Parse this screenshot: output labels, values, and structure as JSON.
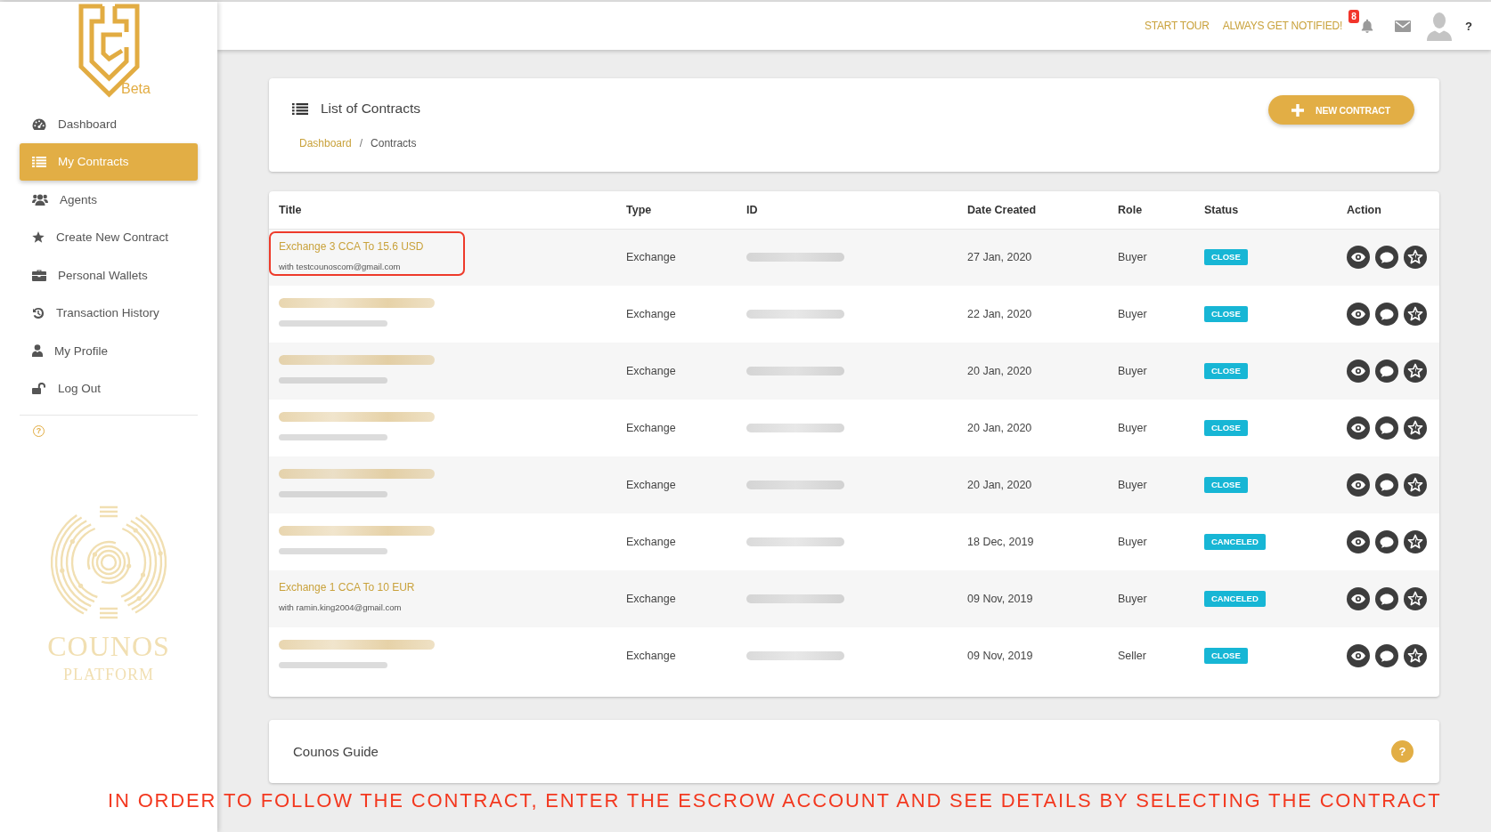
{
  "sidebar": {
    "badge": "Beta",
    "items": [
      {
        "label": "Dashboard",
        "selected": false
      },
      {
        "label": "My Contracts",
        "selected": true
      },
      {
        "label": "Agents",
        "selected": false
      },
      {
        "label": "Create New Contract",
        "selected": false
      },
      {
        "label": "Personal Wallets",
        "selected": false
      },
      {
        "label": "Transaction History",
        "selected": false
      },
      {
        "label": "My Profile",
        "selected": false
      },
      {
        "label": "Log Out",
        "selected": false
      }
    ],
    "help": "?",
    "brand": {
      "name": "COUNOS",
      "tagline": "PLATFORM"
    }
  },
  "topbar": {
    "links": [
      "START TOUR",
      "ALWAYS GET NOTIFIED!"
    ],
    "notification_count": "8",
    "help": "?"
  },
  "header": {
    "title": "List of Contracts",
    "breadcrumb": [
      {
        "label": "Dashboard",
        "kind": "link"
      },
      {
        "label": "Contracts",
        "kind": "current"
      }
    ],
    "separator": "/",
    "button": "NEW CONTRACT"
  },
  "table": {
    "columns": [
      "Title",
      "Type",
      "ID",
      "Date Created",
      "Role",
      "Status",
      "Action"
    ],
    "rows": [
      {
        "blurred": false,
        "title": "Exchange 3 CCA To 15.6 USD",
        "email": "with testcounoscom@gmail.com",
        "type": "Exchange",
        "date": "27 Jan, 2020",
        "role": "Buyer",
        "status": "CLOSE",
        "highlighted": true
      },
      {
        "blurred": true,
        "type": "Exchange",
        "date": "22 Jan, 2020",
        "role": "Buyer",
        "status": "CLOSE",
        "highlighted": false
      },
      {
        "blurred": true,
        "type": "Exchange",
        "date": "20 Jan, 2020",
        "role": "Buyer",
        "status": "CLOSE",
        "highlighted": false
      },
      {
        "blurred": true,
        "type": "Exchange",
        "date": "20 Jan, 2020",
        "role": "Buyer",
        "status": "CLOSE",
        "highlighted": false
      },
      {
        "blurred": true,
        "type": "Exchange",
        "date": "20 Jan, 2020",
        "role": "Buyer",
        "status": "CLOSE",
        "highlighted": false
      },
      {
        "blurred": true,
        "type": "Exchange",
        "date": "18 Dec, 2019",
        "role": "Buyer",
        "status": "CANCELED",
        "highlighted": false
      },
      {
        "blurred": false,
        "title": "Exchange 1 CCA To 10 EUR",
        "email": "with ramin.king2004@gmail.com",
        "type": "Exchange",
        "date": "09 Nov, 2019",
        "role": "Buyer",
        "status": "CANCELED",
        "highlighted": false
      },
      {
        "blurred": true,
        "type": "Exchange",
        "date": "09 Nov, 2019",
        "role": "Seller",
        "status": "CLOSE",
        "highlighted": false
      }
    ]
  },
  "guide": {
    "title": "Counos Guide",
    "help": "?"
  },
  "annotation": {
    "caption": "IN ORDER TO FOLLOW THE CONTRACT, ENTER THE ESCROW ACCOUNT AND SEE DETAILS BY SELECTING THE CONTRACT"
  }
}
